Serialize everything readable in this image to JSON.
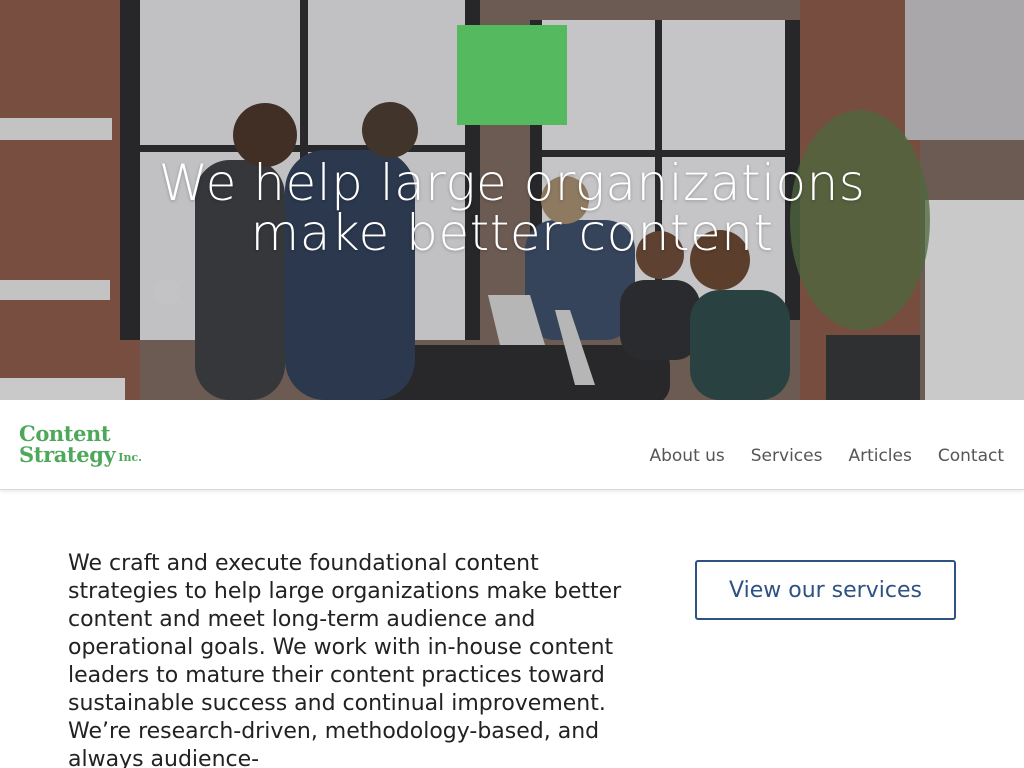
{
  "hero": {
    "title_line1": "We help large organizations",
    "title_line2": "make better content",
    "badge_color": "#55b95f"
  },
  "brand": {
    "line1": "Content",
    "line2": "Strategy",
    "suffix": "Inc.",
    "color": "#4ea85a"
  },
  "nav": {
    "items": [
      {
        "label": "About us"
      },
      {
        "label": "Services"
      },
      {
        "label": "Articles"
      },
      {
        "label": "Contact"
      }
    ]
  },
  "intro": {
    "text": "We craft and execute foundational content strategies to help large organizations make better content and meet long-term audience and operational goals. We work with in-house content leaders to mature their content practices toward sustainable success and continual improvement. We’re research-driven, methodology-based, and always audience-"
  },
  "cta": {
    "label": "View our services",
    "color": "#2e5283"
  }
}
